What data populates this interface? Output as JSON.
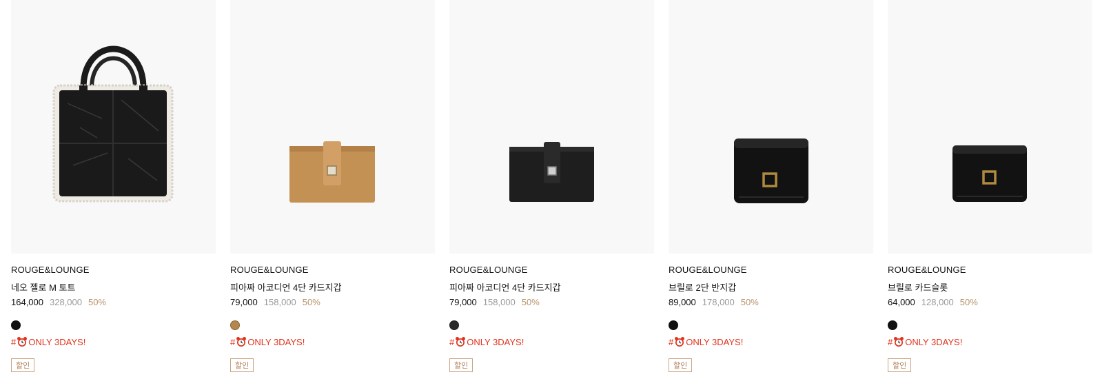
{
  "colors": {
    "discount_rate": "#b8936a",
    "original_price": "#9a9a9a",
    "tag_text": "#e0341d",
    "badge_border": "#c9a383",
    "thumb_bg": "#f8f8f8"
  },
  "products": [
    {
      "brand": "ROUGE&LOUNGE",
      "name": "네오 젤로 M 토트",
      "price": "164,000",
      "original_price": "328,000",
      "discount": "50%",
      "swatch_color": "#111111",
      "tag_prefix": "#",
      "tag_icon": "alarm-clock-icon",
      "tag_text": "ONLY 3DAYS!",
      "badge": "할인"
    },
    {
      "brand": "ROUGE&LOUNGE",
      "name": "피아짜 아코디언 4단 카드지갑",
      "price": "79,000",
      "original_price": "158,000",
      "discount": "50%",
      "swatch_color": "#b5874b",
      "tag_prefix": "#",
      "tag_icon": "alarm-clock-icon",
      "tag_text": "ONLY 3DAYS!",
      "badge": "할인"
    },
    {
      "brand": "ROUGE&LOUNGE",
      "name": "피아짜 아코디언 4단 카드지갑",
      "price": "79,000",
      "original_price": "158,000",
      "discount": "50%",
      "swatch_color": "#2a2a2a",
      "tag_prefix": "#",
      "tag_icon": "alarm-clock-icon",
      "tag_text": "ONLY 3DAYS!",
      "badge": "할인"
    },
    {
      "brand": "ROUGE&LOUNGE",
      "name": "브릴로 2단 반지갑",
      "price": "89,000",
      "original_price": "178,000",
      "discount": "50%",
      "swatch_color": "#111111",
      "tag_prefix": "#",
      "tag_icon": "alarm-clock-icon",
      "tag_text": "ONLY 3DAYS!",
      "badge": "할인"
    },
    {
      "brand": "ROUGE&LOUNGE",
      "name": "브릴로 카드슬롯",
      "price": "64,000",
      "original_price": "128,000",
      "discount": "50%",
      "swatch_color": "#111111",
      "tag_prefix": "#",
      "tag_icon": "alarm-clock-icon",
      "tag_text": "ONLY 3DAYS!",
      "badge": "할인"
    }
  ]
}
